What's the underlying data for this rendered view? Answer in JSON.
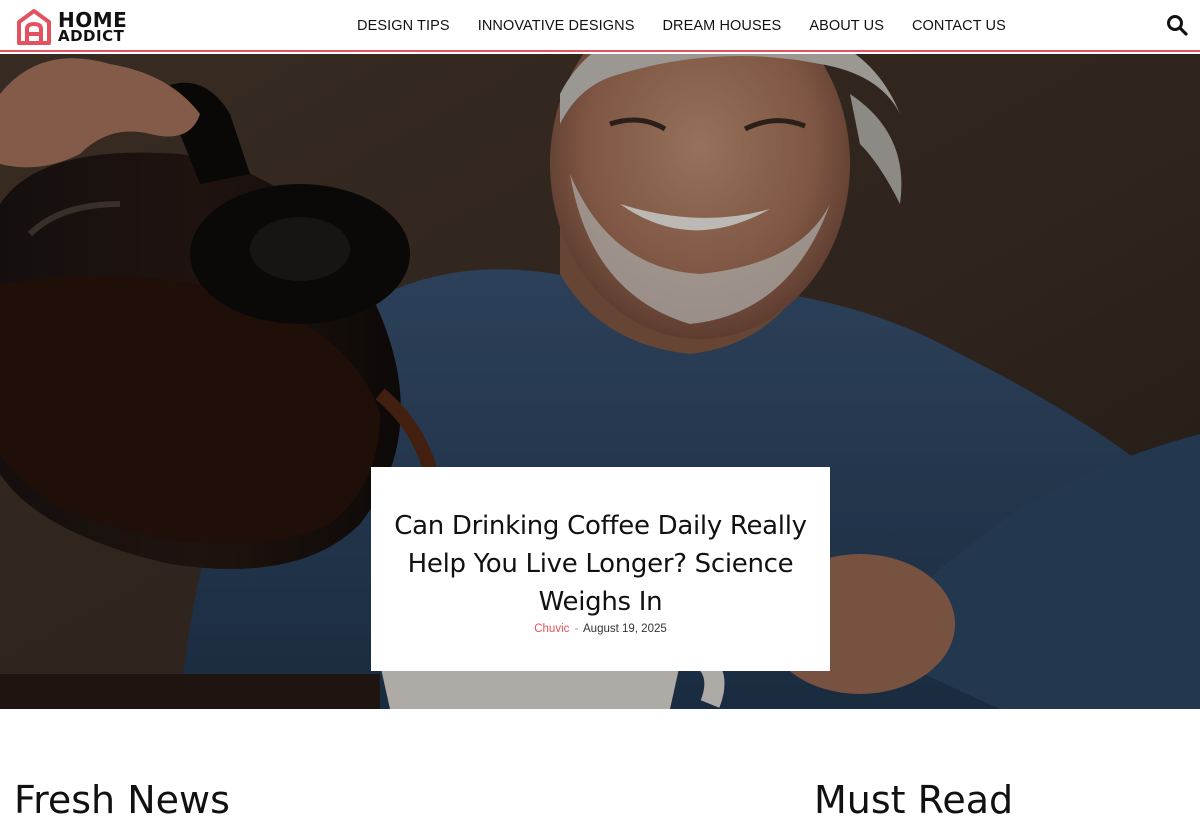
{
  "brand": {
    "line1": "HOME",
    "line2": "ADDICT",
    "accent": "#e3525e"
  },
  "nav": {
    "items": [
      {
        "label": "DESIGN TIPS"
      },
      {
        "label": "INNOVATIVE DESIGNS"
      },
      {
        "label": "DREAM HOUSES"
      },
      {
        "label": "ABOUT US"
      },
      {
        "label": "CONTACT US"
      }
    ],
    "search_icon": "search-icon"
  },
  "hero": {
    "title": "Can Drinking Coffee Daily Really Help You Live Longer? Science Weighs In",
    "author": "Chuvic",
    "separator": "-",
    "date": "August 19, 2025"
  },
  "sections": {
    "fresh_news": "Fresh News",
    "must_read": "Must Read"
  }
}
